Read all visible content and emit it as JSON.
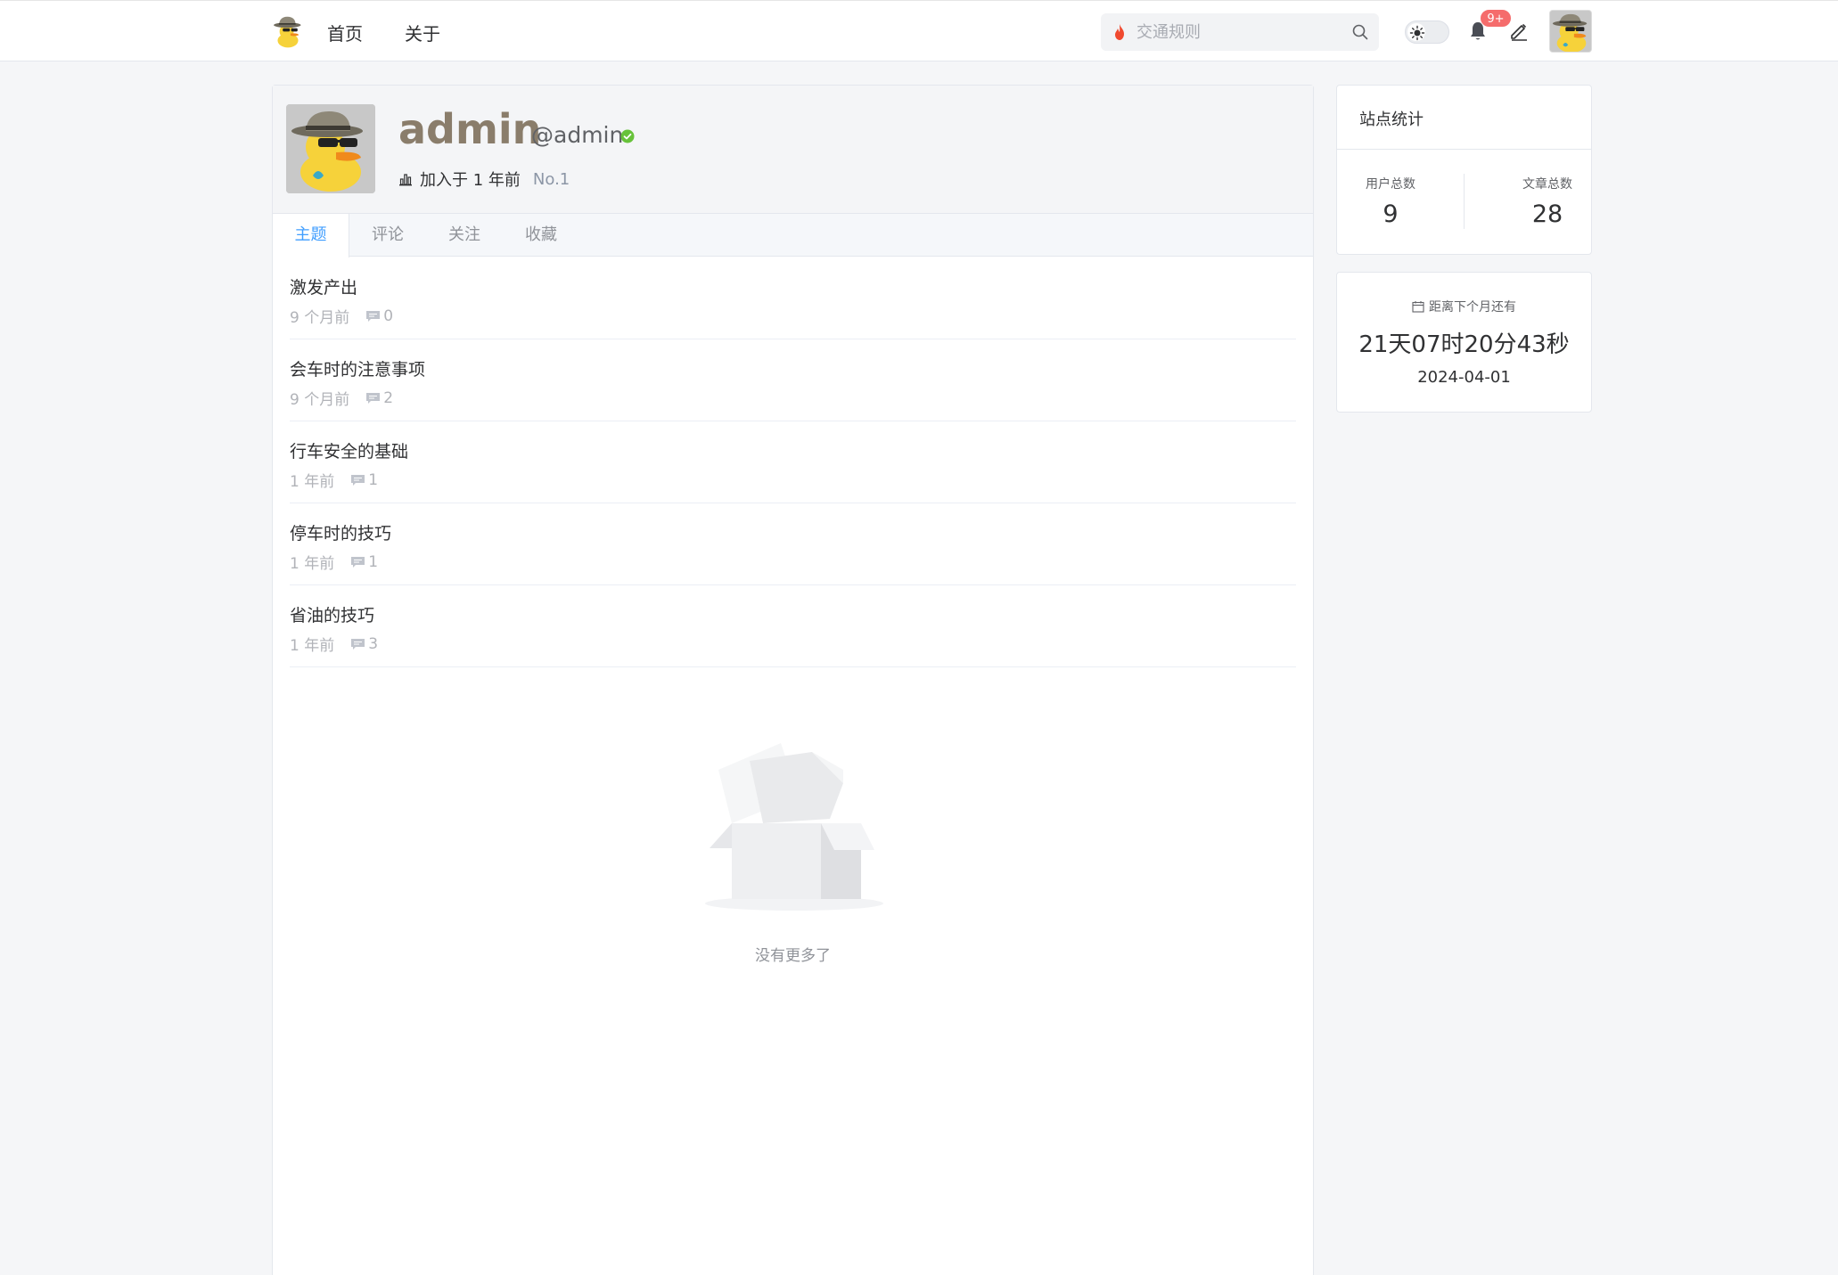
{
  "nav": {
    "home": "首页",
    "about": "关于",
    "search_placeholder": "交通规则",
    "notification_badge": "9+"
  },
  "profile": {
    "name": "admin",
    "handle": "@admin",
    "joined": "加入于 1 年前",
    "rank": "No.1"
  },
  "tabs": [
    "主题",
    "评论",
    "关注",
    "收藏"
  ],
  "topics": [
    {
      "title": "激发产出",
      "time": "9 个月前",
      "comments": "0"
    },
    {
      "title": "会车时的注意事项",
      "time": "9 个月前",
      "comments": "2"
    },
    {
      "title": "行车安全的基础",
      "time": "1 年前",
      "comments": "1"
    },
    {
      "title": "停车时的技巧",
      "time": "1 年前",
      "comments": "1"
    },
    {
      "title": "省油的技巧",
      "time": "1 年前",
      "comments": "3"
    }
  ],
  "empty_text": "没有更多了",
  "stats": {
    "title": "站点统计",
    "users_label": "用户总数",
    "users_value": "9",
    "posts_label": "文章总数",
    "posts_value": "28"
  },
  "countdown": {
    "label": "距离下个月还有",
    "value": "21天07时20分43秒",
    "date": "2024-04-01"
  },
  "colors": {
    "accent": "#409eff",
    "name": "#8a7d6b",
    "badge": "#f56c6c",
    "verified": "#67c23a"
  },
  "icons": [
    "duck-logo",
    "flame-icon",
    "search-icon",
    "sun-icon",
    "bell-icon",
    "pen-icon",
    "verified-icon",
    "bar-chart-icon",
    "comment-icon",
    "calendar-icon",
    "empty-box"
  ]
}
